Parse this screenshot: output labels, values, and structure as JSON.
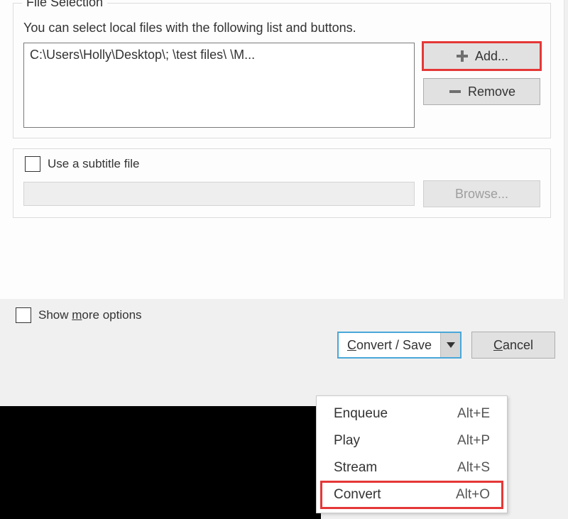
{
  "fileSelection": {
    "legend": "File Selection",
    "hint": "You can select local files with the following list and buttons.",
    "files": [
      "C:\\Users\\Holly\\Desktop\\;     \\test files\\      \\M..."
    ],
    "addLabel": "Add...",
    "removeLabel": "Remove"
  },
  "subtitle": {
    "checkboxLabel": "Use a subtitle file",
    "browseLabel": "Browse..."
  },
  "showMore": {
    "prefix": "Show ",
    "underlined": "m",
    "suffix": "ore options"
  },
  "footer": {
    "convertSave": {
      "underlined": "C",
      "rest": "onvert / Save"
    },
    "cancel": {
      "underlined": "C",
      "rest": "ancel"
    }
  },
  "dropdown": {
    "items": [
      {
        "label": "Enqueue",
        "shortcut": "Alt+E"
      },
      {
        "label": "Play",
        "shortcut": "Alt+P"
      },
      {
        "label": "Stream",
        "shortcut": "Alt+S"
      },
      {
        "label": "Convert",
        "shortcut": "Alt+O",
        "highlight": true
      }
    ]
  }
}
